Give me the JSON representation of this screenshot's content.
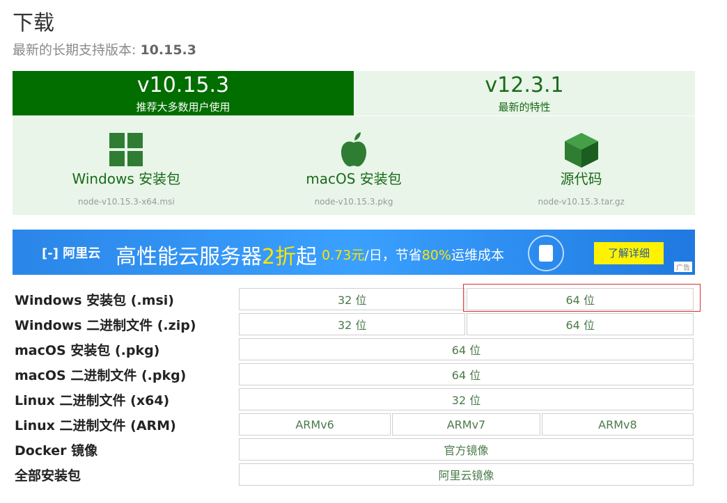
{
  "page": {
    "title": "下载",
    "subtitle_prefix": "最新的长期支持版本:",
    "subtitle_version": "10.15.3"
  },
  "versions": [
    {
      "number": "v10.15.3",
      "desc": "推荐大多数用户使用",
      "active": true
    },
    {
      "number": "v12.3.1",
      "desc": "最新的特性",
      "active": false
    }
  ],
  "downloads": [
    {
      "label": "Windows 安装包",
      "file": "node-v10.15.3-x64.msi",
      "icon": "windows-icon"
    },
    {
      "label": "macOS 安装包",
      "file": "node-v10.15.3.pkg",
      "icon": "apple-icon"
    },
    {
      "label": "源代码",
      "file": "node-v10.15.3.tar.gz",
      "icon": "box-icon"
    }
  ],
  "ad": {
    "logo": "阿里云",
    "slogan_a": "高性能云服务器",
    "slogan_b": "2折",
    "slogan_c": "起",
    "promo_a": "0.73元",
    "promo_b": "/日，节省",
    "promo_c": "80%",
    "promo_d": "运维成本",
    "cta": "了解详细",
    "tag": "广告",
    "colors": {
      "bg": "#2a86e8",
      "highlight": "#ffe400",
      "cta_bg": "#fff200"
    }
  },
  "rows": [
    {
      "label": "Windows 安装包 (.msi)",
      "cells": [
        "32 位",
        "64 位"
      ]
    },
    {
      "label": "Windows 二进制文件 (.zip)",
      "cells": [
        "32 位",
        "64 位"
      ]
    },
    {
      "label": "macOS 安装包 (.pkg)",
      "cells": [
        "64 位"
      ]
    },
    {
      "label": "macOS 二进制文件 (.pkg)",
      "cells": [
        "64 位"
      ]
    },
    {
      "label": "Linux 二进制文件 (x64)",
      "cells": [
        "32 位"
      ]
    },
    {
      "label": "Linux 二进制文件 (ARM)",
      "cells": [
        "ARMv6",
        "ARMv7",
        "ARMv8"
      ]
    },
    {
      "label": "Docker 镜像",
      "cells": [
        "官方镜像"
      ]
    },
    {
      "label": "全部安装包",
      "cells": [
        "阿里云镜像"
      ]
    }
  ],
  "colors": {
    "accent": "#026e00",
    "panel_bg": "#e9f5e9",
    "link": "#1a6a1a",
    "highlight_border": "#d63030"
  }
}
